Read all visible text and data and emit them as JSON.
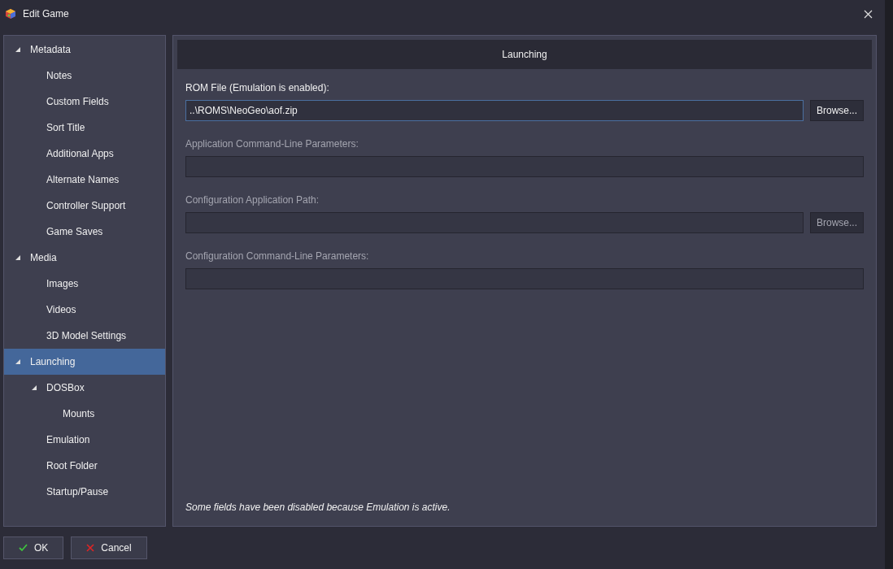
{
  "window": {
    "title": "Edit Game"
  },
  "tree": [
    {
      "label": "Metadata",
      "expanded": true,
      "selected": false,
      "children": [
        {
          "label": "Notes",
          "selected": false
        },
        {
          "label": "Custom Fields",
          "selected": false
        },
        {
          "label": "Sort Title",
          "selected": false
        },
        {
          "label": "Additional Apps",
          "selected": false
        },
        {
          "label": "Alternate Names",
          "selected": false
        },
        {
          "label": "Controller Support",
          "selected": false
        },
        {
          "label": "Game Saves",
          "selected": false
        }
      ]
    },
    {
      "label": "Media",
      "expanded": true,
      "selected": false,
      "children": [
        {
          "label": "Images",
          "selected": false
        },
        {
          "label": "Videos",
          "selected": false
        },
        {
          "label": "3D Model Settings",
          "selected": false
        }
      ]
    },
    {
      "label": "Launching",
      "expanded": true,
      "selected": true,
      "children": [
        {
          "label": "DOSBox",
          "expanded": true,
          "selected": false,
          "children": [
            {
              "label": "Mounts",
              "selected": false
            }
          ]
        },
        {
          "label": "Emulation",
          "selected": false
        },
        {
          "label": "Root Folder",
          "selected": false
        },
        {
          "label": "Startup/Pause",
          "selected": false
        }
      ]
    }
  ],
  "panel": {
    "title": "Launching",
    "fields": [
      {
        "label": "ROM File (Emulation is enabled):",
        "value": "..\\ROMS\\NeoGeo\\aof.zip",
        "disabled": false,
        "focused": true,
        "button": "Browse..."
      },
      {
        "label": "Application Command-Line Parameters:",
        "disabled": true,
        "focused": false
      },
      {
        "label": "Configuration Application Path:",
        "disabled": true,
        "focused": false,
        "button": "Browse..."
      },
      {
        "label": "Configuration Command-Line Parameters:",
        "disabled": true,
        "focused": false
      }
    ],
    "note": "Some fields have been disabled because Emulation is active."
  },
  "buttons": [
    {
      "label": "OK",
      "kind": "ok"
    },
    {
      "label": "Cancel",
      "kind": "cancel"
    }
  ]
}
